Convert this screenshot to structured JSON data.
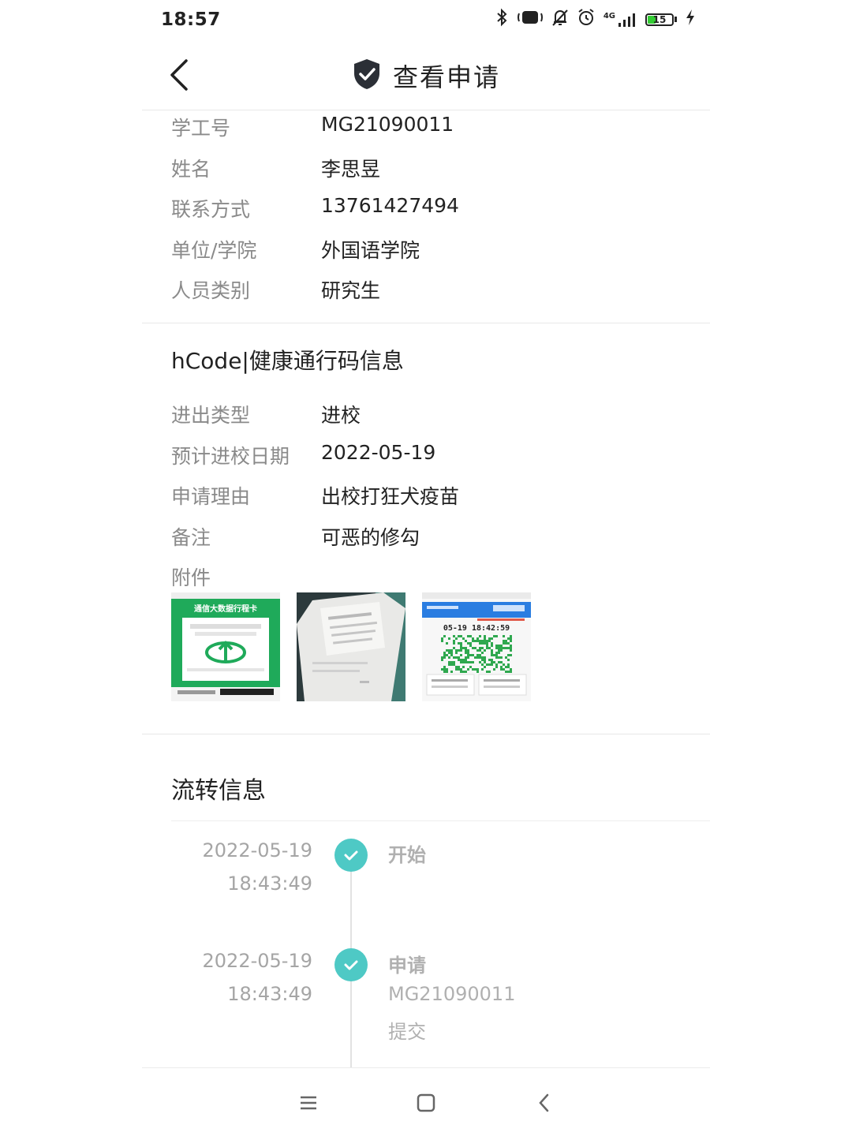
{
  "status_bar": {
    "time": "18:57",
    "network": "4G",
    "battery": "15"
  },
  "header": {
    "title": "查看申请"
  },
  "basic_info": [
    {
      "label": "学工号",
      "value": "MG21090011"
    },
    {
      "label": "姓名",
      "value": "李思昱"
    },
    {
      "label": "联系方式",
      "value": "13761427494"
    },
    {
      "label": "单位/学院",
      "value": "外国语学院"
    },
    {
      "label": "人员类别",
      "value": "研究生"
    }
  ],
  "hcode": {
    "title": "hCode|健康通行码信息",
    "rows": [
      {
        "label": "进出类型",
        "value": "进校"
      },
      {
        "label": "预计进校日期",
        "value": "2022-05-19"
      },
      {
        "label": "申请理由",
        "value": "出校打狂犬疫苗"
      },
      {
        "label": "备注",
        "value": "可恶的修勾"
      }
    ],
    "attachments_label": "附件",
    "attachments": [
      {
        "kind": "travel-card-screenshot",
        "heading": "通信大数据行程卡"
      },
      {
        "kind": "document-photo"
      },
      {
        "kind": "health-code-screenshot",
        "timestamp": "05-19 18:42:59"
      }
    ]
  },
  "flow": {
    "title": "流转信息",
    "events": [
      {
        "date": "2022-05-19",
        "time": "18:43:49",
        "title": "开始",
        "lines": []
      },
      {
        "date": "2022-05-19",
        "time": "18:43:49",
        "title": "申请",
        "lines": [
          "MG21090011",
          "提交"
        ]
      }
    ]
  },
  "colors": {
    "accent": "#4ec9c5",
    "label": "#8a8a8a",
    "text": "#222222",
    "muted": "#b0b0b0"
  }
}
